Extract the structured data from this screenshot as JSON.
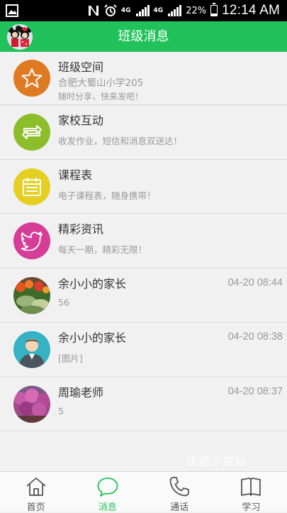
{
  "status_bar": {
    "network_type": "4G",
    "battery_percent": "22%",
    "time": "12:14 AM",
    "icons": [
      "image-notification-icon",
      "nfc-icon",
      "alarm-icon",
      "signal-icon",
      "battery-icon"
    ]
  },
  "header": {
    "title": "班级消息",
    "avatar_icon": "mickey-minnie-avatar"
  },
  "items": [
    {
      "name": "班级空间",
      "subtitle": "合肥大蜀山小学205",
      "detail": "随时分享，快来发吧！",
      "time": "",
      "icon": "star-icon",
      "color": "#e07a22"
    },
    {
      "name": "家校互动",
      "subtitle": "收发作业，短信和消息双送达！",
      "detail": "",
      "time": "",
      "icon": "refresh-icon",
      "color": "#8cbd2b"
    },
    {
      "name": "课程表",
      "subtitle": "电子课程表，随身携带！",
      "detail": "",
      "time": "",
      "icon": "calendar-icon",
      "color": "#e5cf23"
    },
    {
      "name": "精彩资讯",
      "subtitle": "每天一期，精彩无限！",
      "detail": "",
      "time": "",
      "icon": "bird-icon",
      "color": "#d53d96"
    },
    {
      "name": "余小小的家长",
      "subtitle": "56",
      "detail": "",
      "time": "04-20 08:44",
      "icon": "flower-photo-avatar",
      "color": "#4a7a2e"
    },
    {
      "name": "余小小的家长",
      "subtitle": "[图片]",
      "detail": "",
      "time": "04-20 08:38",
      "icon": "person-avatar",
      "color": "#35b3c4"
    },
    {
      "name": "周瑜老师",
      "subtitle": "5",
      "detail": "",
      "time": "04-20 08:37",
      "icon": "flower-tree-photo-avatar",
      "color": "#b03a8a"
    }
  ],
  "watermark": "沃德下载站",
  "tabs": [
    {
      "label": "首页",
      "icon": "home-icon",
      "active": false
    },
    {
      "label": "消息",
      "icon": "chat-bubble-icon",
      "active": true
    },
    {
      "label": "通话",
      "icon": "phone-icon",
      "active": false
    },
    {
      "label": "学习",
      "icon": "book-icon",
      "active": false
    }
  ],
  "colors": {
    "accent": "#22c25b",
    "background": "#f1f1f1",
    "muted_text": "#999999"
  }
}
